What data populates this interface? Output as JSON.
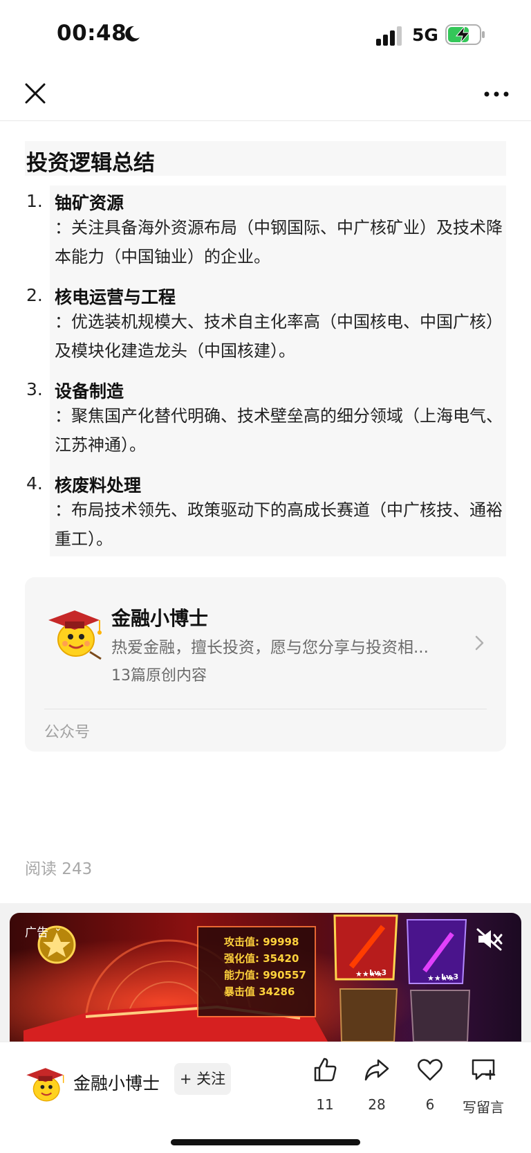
{
  "status_bar": {
    "time": "00:48",
    "network": "5G"
  },
  "article": {
    "heading": "投资逻辑总结",
    "items": [
      {
        "num": "1.",
        "title": "铀矿资源",
        "desc": "：关注具备海外资源布局（中钢国际、中广核矿业）及技术降本能力（中国铀业）的企业。"
      },
      {
        "num": "2.",
        "title": "核电运营与工程",
        "desc": "：优选装机规模大、技术自主化率高（中国核电、中国广核）及模块化建造龙头（中国核建）。"
      },
      {
        "num": "3.",
        "title": "设备制造",
        "desc": "：聚焦国产化替代明确、技术壁垒高的细分领域（上海电气、江苏神通）。"
      },
      {
        "num": "4.",
        "title": "核废料处理",
        "desc": "：布局技术领先、政策驱动下的高成长赛道（中广核技、通裕重工）。"
      }
    ]
  },
  "account_card": {
    "name": "金融小博士",
    "description": "热爱金融，擅长投资，愿与您分享与投资相...",
    "count": "13篇原创内容",
    "footer": "公众号"
  },
  "read_count": "阅读 243",
  "ad": {
    "label": "广告",
    "stats": [
      "攻击值: 99998",
      "强化值: 35420",
      "能力值: 990557",
      "暴击值 34286"
    ],
    "badge1": "Lv.3",
    "badge2": "Lv.3"
  },
  "bottom_bar": {
    "name": "金融小博士",
    "follow_label": "+ 关注",
    "likes": "11",
    "shares": "28",
    "favorites": "6",
    "comment_label": "写留言"
  }
}
